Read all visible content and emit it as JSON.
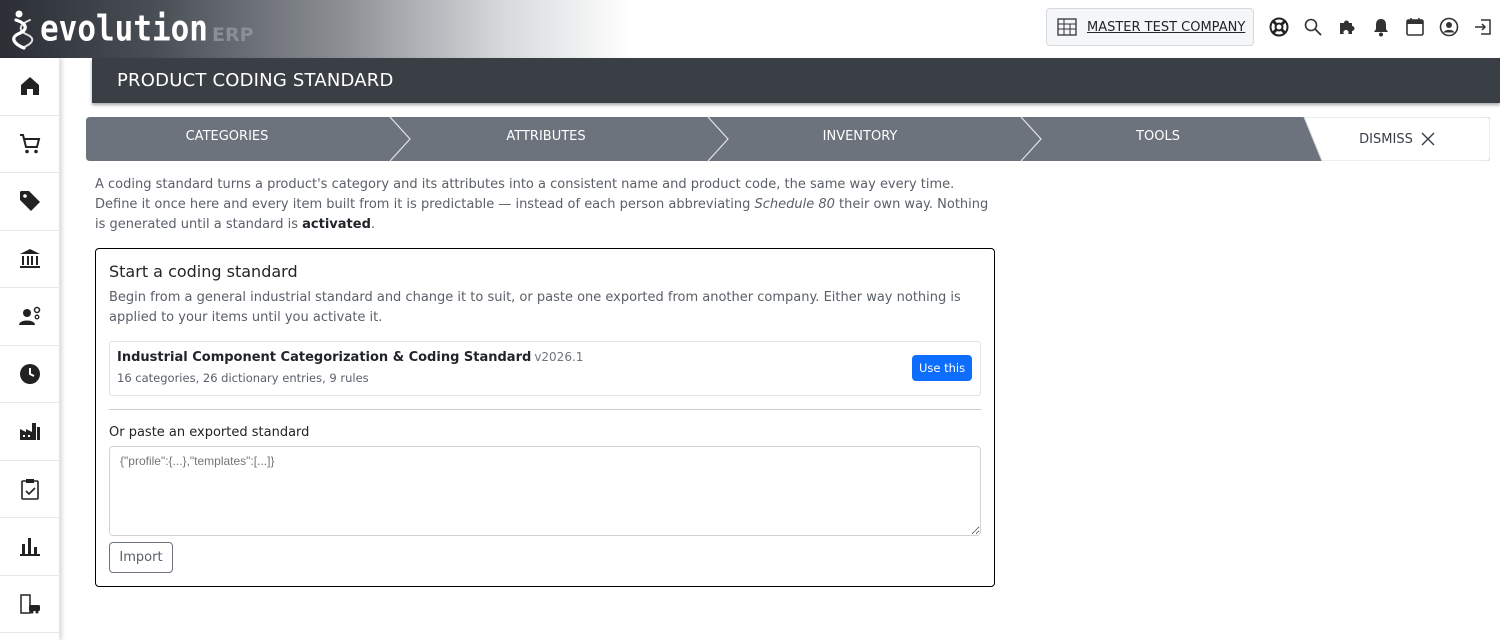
{
  "header": {
    "logo_text": "evolution",
    "logo_suffix": "ERP",
    "company_name": "MASTER TEST COMPANY",
    "icons": [
      "lifebuoy-icon",
      "search-icon",
      "puzzle-icon",
      "bell-icon",
      "calendar-icon",
      "user-circle-icon",
      "logout-icon"
    ]
  },
  "sidebar": {
    "items": [
      "home-icon",
      "cart-icon",
      "tag-icon",
      "bank-icon",
      "users-settings-icon",
      "clock-icon",
      "factory-icon",
      "clipboard-check-icon",
      "bar-chart-icon",
      "building-car-icon"
    ]
  },
  "page": {
    "title": "PRODUCT CODING STANDARD"
  },
  "steps": {
    "items": [
      "CATEGORIES",
      "ATTRIBUTES",
      "INVENTORY",
      "TOOLS"
    ],
    "dismiss_label": "DISMISS"
  },
  "intro": {
    "part1": "A coding standard turns a product's category and its attributes into a consistent name and product code, the same way every time. Define it once here and every item built from it is predictable — instead of each person abbreviating ",
    "emphasis": "Schedule 80",
    "part2": " their own way. Nothing is generated until a standard is ",
    "bold": "activated",
    "part3": "."
  },
  "card": {
    "title": "Start a coding standard",
    "description": "Begin from a general industrial standard and change it to suit, or paste one exported from another company. Either way nothing is applied to your items until you activate it.",
    "standard_name": "Industrial Component Categorization & Coding Standard",
    "standard_version": "v2026.1",
    "standard_meta": "16 categories, 26 dictionary entries, 9 rules",
    "use_button": "Use this",
    "paste_label": "Or paste an exported standard",
    "paste_placeholder": "{\"profile\":{...},\"templates\":[...]}",
    "import_button": "Import"
  },
  "colors": {
    "header_bg": "#3a3f46",
    "step_bg": "#6c737c",
    "primary": "#0d6efd"
  }
}
